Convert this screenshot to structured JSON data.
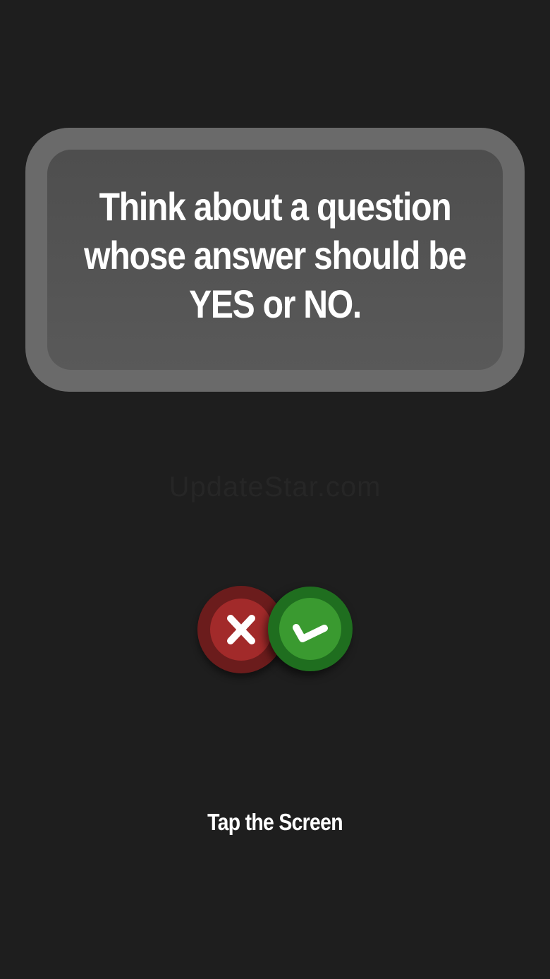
{
  "prompt": {
    "lines": [
      "Think about a question",
      "whose answer should be",
      "YES or NO."
    ]
  },
  "watermark": "UpdateStar.com",
  "buttons": {
    "no": {
      "icon": "cross-icon",
      "color": "#a22a2a"
    },
    "yes": {
      "icon": "checkmark-icon",
      "color": "#3a9a30"
    }
  },
  "hint": "Tap the Screen",
  "colors": {
    "background": "#1e1e1e",
    "card_outer": "#6a6a6a",
    "card_inner": "#545454"
  }
}
